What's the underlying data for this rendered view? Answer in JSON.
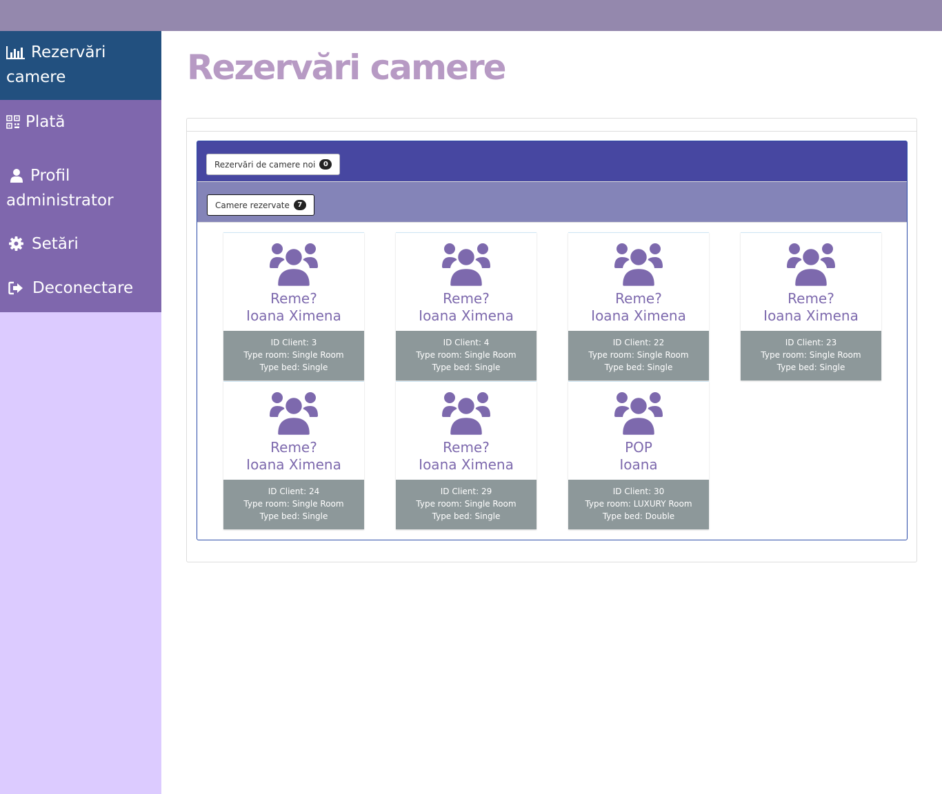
{
  "colors": {
    "topbar": "#9488ad",
    "sidebar_bg": "#dccbff",
    "sidebar_menu": "#7f67ad",
    "sidebar_active": "#22507f",
    "title": "#b79ac4",
    "panel_head": "#4747a1",
    "panel_sub": "#8484b8",
    "card_text": "#7d69ad",
    "card_info": "#8d989a"
  },
  "sidebar": {
    "items": [
      {
        "label": "Rezervări camere",
        "icon": "bar-chart-icon",
        "active": true
      },
      {
        "label": "Plată",
        "icon": "qrcode-icon"
      },
      {
        "label": "Profil administrator",
        "icon": "user-icon"
      },
      {
        "label": "Setări",
        "icon": "gear-icon"
      },
      {
        "label": "Deconectare",
        "icon": "sign-out-icon"
      }
    ]
  },
  "page": {
    "title": "Rezervări camere"
  },
  "tabs": {
    "new": {
      "label": "Rezervări de camere noi",
      "count": "0"
    },
    "booked": {
      "label": "Camere rezervate",
      "count": "7"
    }
  },
  "cards": [
    {
      "line1": "Reme?",
      "line2": "Ioana Ximena",
      "id": "ID Client: 3",
      "room": "Type room: Single Room",
      "bed": "Type bed: Single"
    },
    {
      "line1": "Reme?",
      "line2": "Ioana Ximena",
      "id": "ID Client: 4",
      "room": "Type room: Single Room",
      "bed": "Type bed: Single"
    },
    {
      "line1": "Reme?",
      "line2": "Ioana Ximena",
      "id": "ID Client: 22",
      "room": "Type room: Single Room",
      "bed": "Type bed: Single"
    },
    {
      "line1": "Reme?",
      "line2": "Ioana Ximena",
      "id": "ID Client: 23",
      "room": "Type room: Single Room",
      "bed": "Type bed: Single"
    },
    {
      "line1": "Reme?",
      "line2": "Ioana Ximena",
      "id": "ID Client: 24",
      "room": "Type room: Single Room",
      "bed": "Type bed: Single"
    },
    {
      "line1": "Reme?",
      "line2": "Ioana Ximena",
      "id": "ID Client: 29",
      "room": "Type room: Single Room",
      "bed": "Type bed: Single"
    },
    {
      "line1": "POP",
      "line2": "Ioana",
      "id": "ID Client: 30",
      "room": "Type room: LUXURY Room",
      "bed": "Type bed: Double"
    }
  ]
}
